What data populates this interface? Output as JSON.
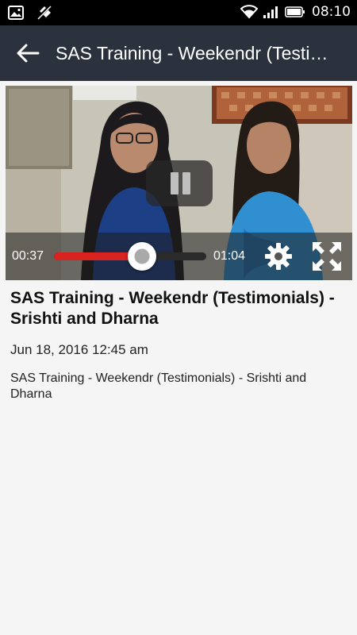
{
  "status_bar": {
    "time": "08:10",
    "icons": [
      "image-icon",
      "signal-off-icon",
      "wifi-icon",
      "cell-signal-icon",
      "battery-icon"
    ]
  },
  "app_bar": {
    "title": "SAS Training - Weekendr (Testimonials) - Srishti and Dharna",
    "back_icon": "arrow-back-icon"
  },
  "video_player": {
    "current_time": "00:37",
    "duration": "01:04",
    "progress_fraction": 0.578,
    "state": "playing",
    "controls": [
      "pause-icon",
      "settings-gear-icon",
      "fullscreen-icon"
    ],
    "accent_color": "#d8231f"
  },
  "video": {
    "title": "SAS Training - Weekendr (Testimonials) - Srishti and Dharna",
    "date": "Jun 18, 2016 12:45 am",
    "description": "SAS Training - Weekendr (Testimonials) - Srishti and Dharna"
  },
  "colors": {
    "app_bar": "#2c323d",
    "status_bar": "#000000",
    "background": "#f5f5f5"
  }
}
